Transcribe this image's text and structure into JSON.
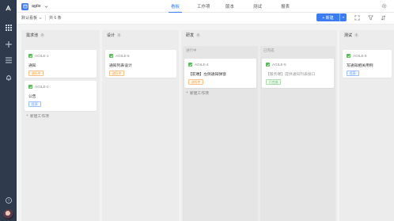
{
  "project": {
    "name": "agile"
  },
  "topnav": {
    "tabs": [
      {
        "label": "看板",
        "active": true
      },
      {
        "label": "工作项",
        "active": false
      },
      {
        "label": "版本",
        "active": false
      },
      {
        "label": "测试",
        "active": false
      },
      {
        "label": "报表",
        "active": false
      }
    ]
  },
  "toolbar": {
    "view_label": "默认看板",
    "count_label": "共 6 条",
    "new_button": "新建"
  },
  "columns": [
    {
      "title": "需求池",
      "count": "2",
      "cards": [
        {
          "id": "AGILE-1",
          "title": "通知",
          "tag": "进行中",
          "tag_color": "orange"
        },
        {
          "id": "AGILE-2",
          "title": "公告",
          "tag": "打开",
          "tag_color": "blue"
        }
      ],
      "add_label": "新建工作项"
    },
    {
      "title": "设计",
      "count": "1",
      "cards": [
        {
          "id": "AGILE-6",
          "title": "通知列表设计",
          "tag": "进行中",
          "tag_color": "orange"
        }
      ]
    },
    {
      "title": "研发",
      "count": "2",
      "subcolumns": [
        {
          "title": "进行中",
          "cards": [
            {
              "id": "AGILE-4",
              "title": "【前端】左侧通知弹窗",
              "tag": "进行中",
              "tag_color": "orange"
            }
          ],
          "add_label": "新建工作项"
        },
        {
          "title": "已完成",
          "cards": [
            {
              "id": "AGILE-5",
              "title": "【服务端】提供通知列表接口",
              "tag": "已完成",
              "tag_color": "green"
            }
          ]
        }
      ]
    },
    {
      "title": "测试",
      "count": "1",
      "cards": [
        {
          "id": "AGILE-8",
          "title": "写通知相关用例",
          "tag": "打开",
          "tag_color": "blue"
        }
      ]
    }
  ],
  "colors": {
    "accent": "#3b7cf2",
    "rail": "#2f3a4c",
    "done_check": "#5cb85c"
  }
}
